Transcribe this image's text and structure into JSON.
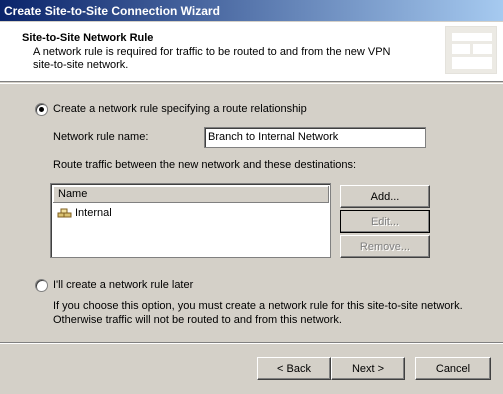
{
  "window": {
    "title": "Create Site-to-Site Connection Wizard"
  },
  "header": {
    "title": "Site-to-Site Network Rule",
    "description": "A network rule is required for traffic to be routed to and from the new VPN site-to-site network."
  },
  "option_create": {
    "label": "Create a network rule specifying a route relationship",
    "selected": true
  },
  "rule_name": {
    "label": "Network rule name:",
    "value": "Branch to Internal Network"
  },
  "destinations": {
    "label": "Route traffic between the new network and these destinations:",
    "column_name": "Name",
    "items": [
      {
        "name": "Internal",
        "icon": "network-icon"
      }
    ]
  },
  "list_buttons": {
    "add": "Add...",
    "edit": "Edit...",
    "remove": "Remove..."
  },
  "option_later": {
    "label": "I'll create a network rule later",
    "selected": false,
    "description_line1": "If you choose this option, you must create a network rule for this site-to-site network.",
    "description_line2": "Otherwise traffic will not be routed to and from this network."
  },
  "footer": {
    "back": "< Back",
    "next": "Next >",
    "cancel": "Cancel"
  }
}
